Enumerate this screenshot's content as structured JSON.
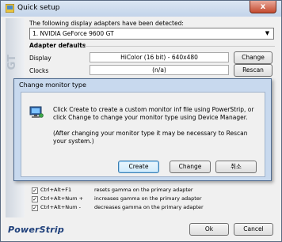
{
  "window": {
    "title": "Quick setup",
    "close_label": "x"
  },
  "side_label": "GT",
  "detected_label": "The following display adapters have been detected:",
  "adapter_select": "1. NVIDIA GeForce 9600 GT",
  "adapter_defaults": {
    "heading": "Adapter defaults",
    "display_label": "Display",
    "display_value": "HiColor (16 bit) - 640x480",
    "display_button": "Change",
    "clocks_label": "Clocks",
    "clocks_value": "(n/a)",
    "clocks_button": "Rescan"
  },
  "dialog": {
    "title": "Change monitor type",
    "message_line1": "Click Create to create a custom monitor inf file using PowerStrip, or",
    "message_line2": "click Change to change your monitor type using Device Manager.",
    "note_line1": "(After changing your monitor type it may be necessary to Rescan",
    "note_line2": "your system.)",
    "create_button": "Create",
    "change_button": "Change",
    "cancel_button": "취소"
  },
  "hotkeys": [
    {
      "keys": "Ctrl+Alt+F1",
      "desc": "resets gamma on the primary adapter",
      "checked": true
    },
    {
      "keys": "Ctrl+Alt+Num +",
      "desc": "increases gamma on the primary adapter",
      "checked": true
    },
    {
      "keys": "Ctrl+Alt+Num -",
      "desc": "decreases gamma on the primary adapter",
      "checked": true
    }
  ],
  "brand": "PowerStrip",
  "footer": {
    "ok_button": "Ok",
    "cancel_button": "Cancel"
  }
}
